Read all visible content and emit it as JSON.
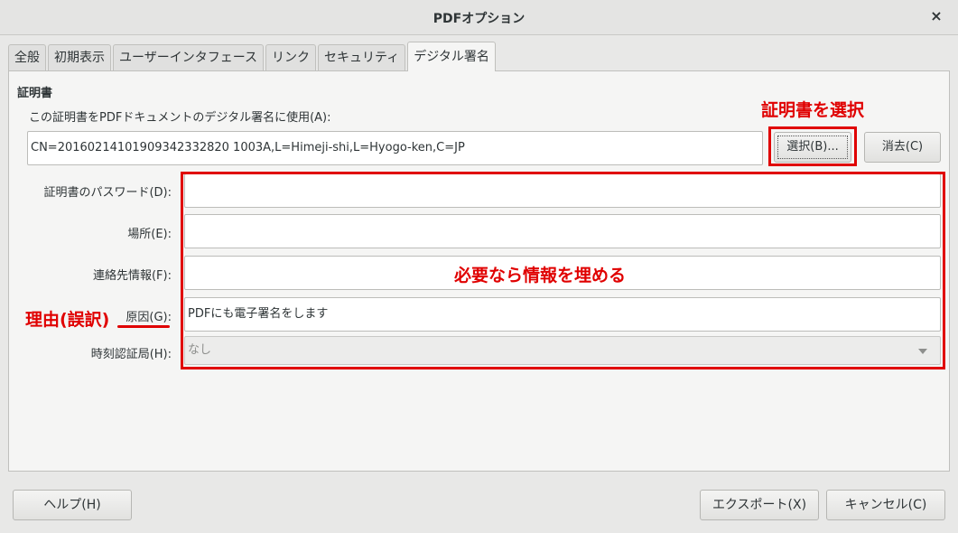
{
  "window": {
    "title": "PDFオプション",
    "close_glyph": "×"
  },
  "tabs": [
    {
      "label": "全般",
      "active": false
    },
    {
      "label": "初期表示",
      "active": false
    },
    {
      "label": "ユーザーインタフェース",
      "active": false
    },
    {
      "label": "リンク",
      "active": false
    },
    {
      "label": "セキュリティ",
      "active": false
    },
    {
      "label": "デジタル署名",
      "active": true
    }
  ],
  "certificate": {
    "section_title": "証明書",
    "use_label": "この証明書をPDFドキュメントのデジタル署名に使用(A):",
    "value": "CN=20160214101909342332820 1003A,L=Himeji-shi,L=Hyogo-ken,C=JP",
    "select_button": "選択(B)...",
    "clear_button": "消去(C)"
  },
  "form": {
    "password_label": "証明書のパスワード(D):",
    "password_value": "",
    "location_label": "場所(E):",
    "location_value": "",
    "contact_label": "連絡先情報(F):",
    "contact_value": "",
    "reason_label": "原因(G):",
    "reason_value": "PDFにも電子署名をします",
    "tsa_label": "時刻認証局(H):",
    "tsa_value": "なし"
  },
  "annotations": {
    "select_note": "証明書を選択",
    "fill_note": "必要なら情報を埋める",
    "reason_note": "理由(誤訳)"
  },
  "footer": {
    "help_button": "ヘルプ(H)",
    "export_button": "エクスポート(X)",
    "cancel_button": "キャンセル(C)"
  },
  "colors": {
    "annotation": "#e00000",
    "panel": "#f5f5f4",
    "window": "#e8e8e7"
  }
}
